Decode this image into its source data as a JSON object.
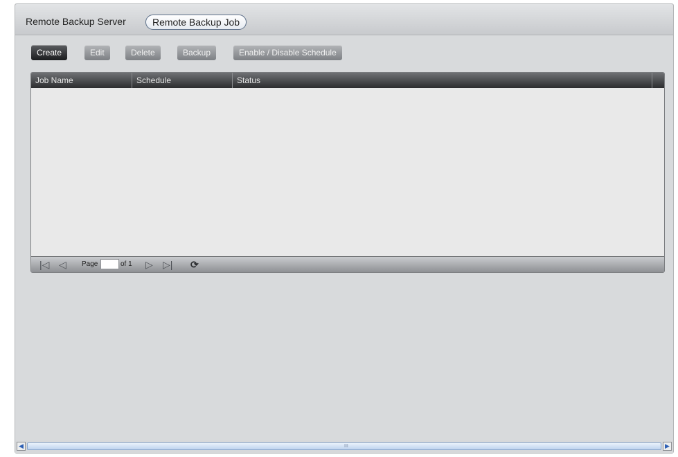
{
  "tabs": [
    "Remote Backup Server",
    "Remote Backup Job"
  ],
  "toolbar": {
    "create": "Create",
    "edit": "Edit",
    "delete": "Delete",
    "backup": "Backup",
    "schedule": "Enable / Disable Schedule"
  },
  "table": {
    "columns": [
      "Job Name",
      "Schedule",
      "Status"
    ],
    "rows": []
  },
  "pager": {
    "page_label": "Page",
    "page_value": "",
    "of_label": "of 1"
  },
  "scrollbar": {
    "grip": "III"
  }
}
